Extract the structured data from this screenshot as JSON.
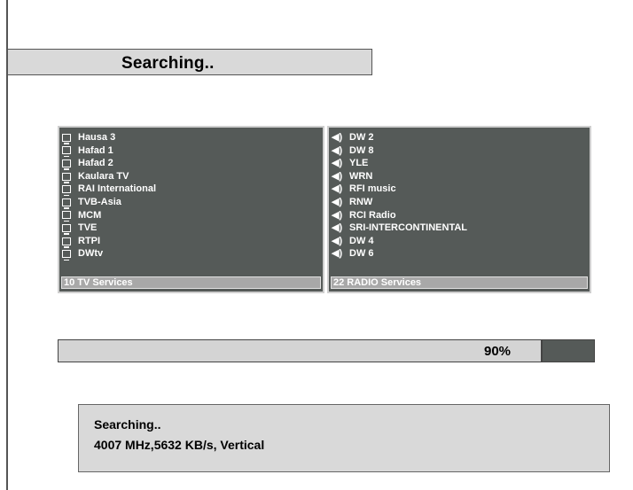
{
  "header": {
    "title": "Searching.."
  },
  "tv_panel": {
    "items": [
      "Hausa 3",
      "Hafad 1",
      "Hafad 2",
      "Kaulara TV",
      "RAI International",
      "TVB-Asia",
      "MCM",
      "TVE",
      "RTPI",
      "DWtv"
    ],
    "footer": "10 TV Services"
  },
  "radio_panel": {
    "items": [
      "DW 2",
      "DW 8",
      "YLE",
      "WRN",
      "RFI music",
      "RNW",
      "RCI Radio",
      "SRI-INTERCONTINENTAL",
      "DW 4",
      "DW 6"
    ],
    "footer": "22 RADIO Services"
  },
  "progress": {
    "percent": 90,
    "label": "90%"
  },
  "status": {
    "line1": "Searching..",
    "line2": "4007 MHz,5632 KB/s, Vertical"
  },
  "colors": {
    "panel_bg": "#555a58",
    "bar_bg": "#d9d9d9",
    "footer_bg": "#a8a8a8"
  },
  "icons": {
    "tv": "tv-icon",
    "radio": "speaker-icon"
  }
}
